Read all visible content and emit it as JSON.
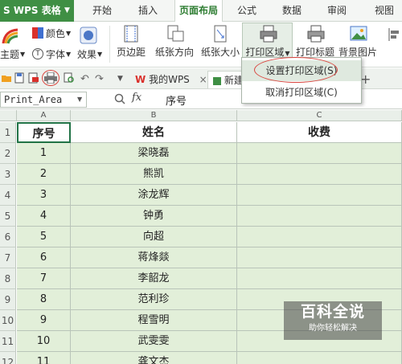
{
  "app": {
    "title": "WPS 表格",
    "logo": "S"
  },
  "menu": [
    {
      "label": "开始"
    },
    {
      "label": "插入"
    },
    {
      "label": "页面布局",
      "active": true
    },
    {
      "label": "公式"
    },
    {
      "label": "数据"
    },
    {
      "label": "审阅"
    },
    {
      "label": "视图"
    }
  ],
  "ribbon": {
    "theme": "主题",
    "font": "字体",
    "color": "颜色",
    "effect": "效果",
    "margins": "页边距",
    "orientation": "纸张方向",
    "size": "纸张大小",
    "print_area": "打印区域",
    "print_titles": "打印标题",
    "background": "背景图片"
  },
  "print_area_menu": {
    "set": "设置打印区域(S)",
    "cancel": "取消打印区域(C)"
  },
  "tabs": {
    "my_wps": "我的WPS",
    "new": "新建"
  },
  "formula_bar": {
    "name_box": "Print_Area",
    "fx": "fx",
    "value": "序号"
  },
  "grid": {
    "columns": [
      "A",
      "B",
      "C"
    ],
    "headers": [
      "序号",
      "姓名",
      "收费"
    ],
    "row_numbers": [
      "1",
      "2",
      "3",
      "4",
      "5",
      "6",
      "7",
      "8",
      "9",
      "10",
      "11",
      "12"
    ],
    "rows": [
      [
        "1",
        "梁晓磊",
        ""
      ],
      [
        "2",
        "熊凯",
        ""
      ],
      [
        "3",
        "涂龙辉",
        ""
      ],
      [
        "4",
        "钟勇",
        ""
      ],
      [
        "5",
        "向超",
        ""
      ],
      [
        "6",
        "蒋烽燚",
        ""
      ],
      [
        "7",
        "李韶龙",
        ""
      ],
      [
        "8",
        "范利珍",
        ""
      ],
      [
        "9",
        "程雪明",
        ""
      ],
      [
        "10",
        "武雯雯",
        ""
      ],
      [
        "11",
        "龚文杰",
        ""
      ]
    ]
  },
  "watermark": {
    "title": "百科全说",
    "subtitle": "助你轻松解决"
  },
  "colors": {
    "accent": "#3f8f44",
    "cell_fill": "#e2efd9",
    "highlight": "#d9453f"
  }
}
